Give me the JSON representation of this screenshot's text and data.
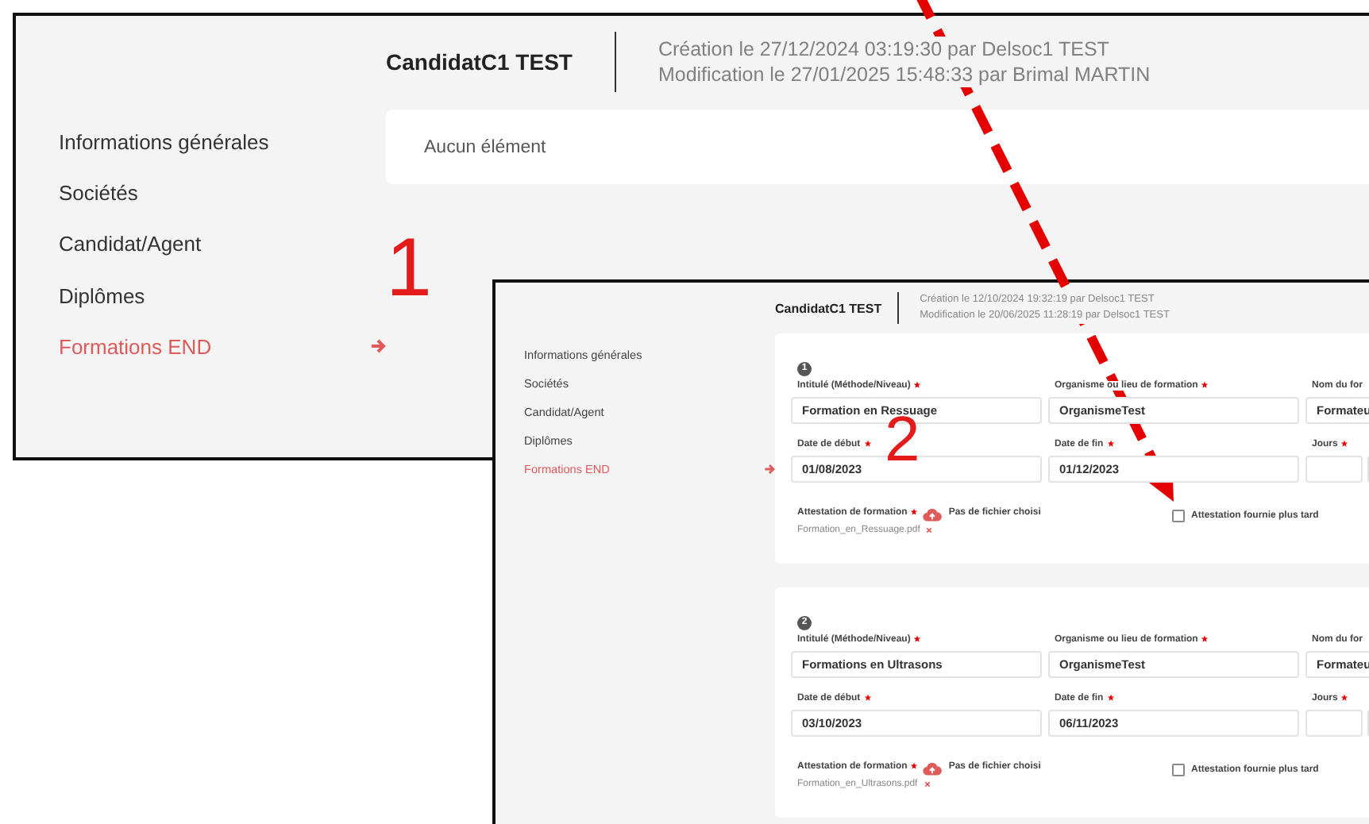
{
  "first_screenshot": {
    "header": {
      "name": "CandidatC1 TEST",
      "meta": [
        "Création le 27/12/2024 03:19:30 par Delsoc1 TEST",
        "Modification le 27/01/2025 15:48:33 par Brimal MARTIN"
      ]
    },
    "sidebar": [
      {
        "label": "Informations générales",
        "selected": false
      },
      {
        "label": "Sociétés",
        "selected": false
      },
      {
        "label": "Candidat/Agent",
        "selected": false
      },
      {
        "label": "Diplômes",
        "selected": false
      },
      {
        "label": "Formations END",
        "selected": true
      }
    ],
    "empty_message": "Aucun élément"
  },
  "second_screenshot": {
    "header": {
      "name": "CandidatC1 TEST",
      "meta": [
        "Création le 12/10/2024 19:32:19 par Delsoc1 TEST",
        "Modification le 20/06/2025 11:28:19 par Delsoc1 TEST"
      ]
    },
    "sidebar": [
      {
        "label": "Informations générales",
        "selected": false
      },
      {
        "label": "Sociétés",
        "selected": false
      },
      {
        "label": "Candidat/Agent",
        "selected": false
      },
      {
        "label": "Diplômes",
        "selected": false
      },
      {
        "label": "Formations END",
        "selected": true
      }
    ],
    "formations": [
      {
        "number": "1",
        "fields": [
          {
            "kind": "text",
            "label": "Intitulé (Méthode/Niveau)",
            "required": true,
            "value": "Formation en Ressuage"
          },
          {
            "kind": "text",
            "label": "Organisme ou lieu de formation",
            "required": true,
            "value": "OrganismeTest"
          },
          {
            "kind": "text",
            "label": "Nom du for",
            "value": "Formateu"
          },
          {
            "kind": "text",
            "label": "Date de début",
            "required": true,
            "value": "01/08/2023"
          },
          {
            "kind": "text",
            "label": "Date de fin",
            "required": true,
            "value": "01/12/2023"
          },
          {
            "kind": "pair",
            "label": "Jours",
            "required": true
          }
        ],
        "attestation": {
          "label": "Attestation de formation",
          "required": true,
          "file_status": "Pas de fichier choisi",
          "file_name": "Formation_en_Ressuage.pdf",
          "later_label": "Attestation fournie plus tard",
          "later_checked": false
        }
      },
      {
        "number": "2",
        "fields": [
          {
            "kind": "text",
            "label": "Intitulé (Méthode/Niveau)",
            "required": true,
            "value": "Formations en Ultrasons"
          },
          {
            "kind": "text",
            "label": "Organisme ou lieu de formation",
            "required": true,
            "value": "OrganismeTest"
          },
          {
            "kind": "text",
            "label": "Nom du for",
            "value": "Formateu"
          },
          {
            "kind": "text",
            "label": "Date de début",
            "required": true,
            "value": "03/10/2023"
          },
          {
            "kind": "text",
            "label": "Date de fin",
            "required": true,
            "value": "06/11/2023"
          },
          {
            "kind": "pair",
            "label": "Jours",
            "required": true
          }
        ],
        "attestation": {
          "label": "Attestation de formation",
          "required": true,
          "file_status": "Pas de fichier choisi",
          "file_name": "Formation_en_Ultrasons.pdf",
          "later_label": "Attestation fournie plus tard",
          "later_checked": false
        }
      }
    ]
  },
  "annotations": [
    {
      "label": "1"
    },
    {
      "label": "2"
    }
  ]
}
